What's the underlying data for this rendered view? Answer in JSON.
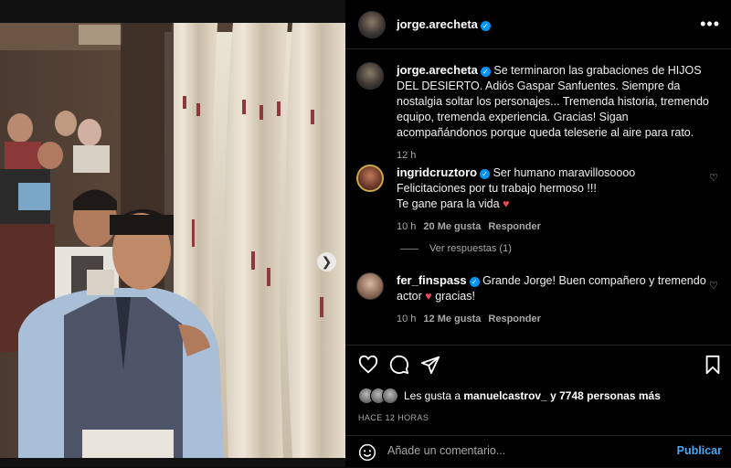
{
  "post": {
    "author": "jorge.arecheta",
    "caption": "Se terminaron las grabaciones de HIJOS DEL DESIERTO. Adiós Gaspar Sanfuentes. Siempre da nostalgia soltar los personajes... Tremenda historia, tremendo equipo, tremenda experiencia. Gracias! Sigan acompañándonos porque queda teleserie al aire para rato.",
    "caption_time": "12 h"
  },
  "comments": [
    {
      "user": "ingridcruztoro",
      "text": "Ser humano maravillosoooo",
      "text2": "Felicitaciones por tu trabajo hermoso !!!",
      "text3": "Te gane para la vida",
      "time": "10 h",
      "likes": "20 Me gusta",
      "reply": "Responder",
      "view_replies": "Ver respuestas (1)"
    },
    {
      "user": "fer_finspass",
      "text": "Grande Jorge! Buen compañero y tremendo actor",
      "text2": "gracias!",
      "time": "10 h",
      "likes": "12 Me gusta",
      "reply": "Responder"
    }
  ],
  "likes": {
    "prefix": "Les gusta a",
    "user": "manuelcastrov_",
    "suffix": "y 7748 personas más"
  },
  "time_ago": "HACE 12 HORAS",
  "comment_box": {
    "placeholder": "Añade un comentario...",
    "publish": "Publicar"
  },
  "carousel": {
    "slides": 6,
    "active": 1
  },
  "icons": {
    "like": "heart-icon",
    "comment": "comment-icon",
    "share": "share-icon",
    "save": "bookmark-icon",
    "more": "more-icon",
    "emoji": "emoji-icon",
    "next": "chevron-right-icon",
    "verified": "verified-badge-icon"
  },
  "colors": {
    "verified": "#0095f6",
    "publish": "#4aa7f5",
    "heart": "#ed4956"
  }
}
